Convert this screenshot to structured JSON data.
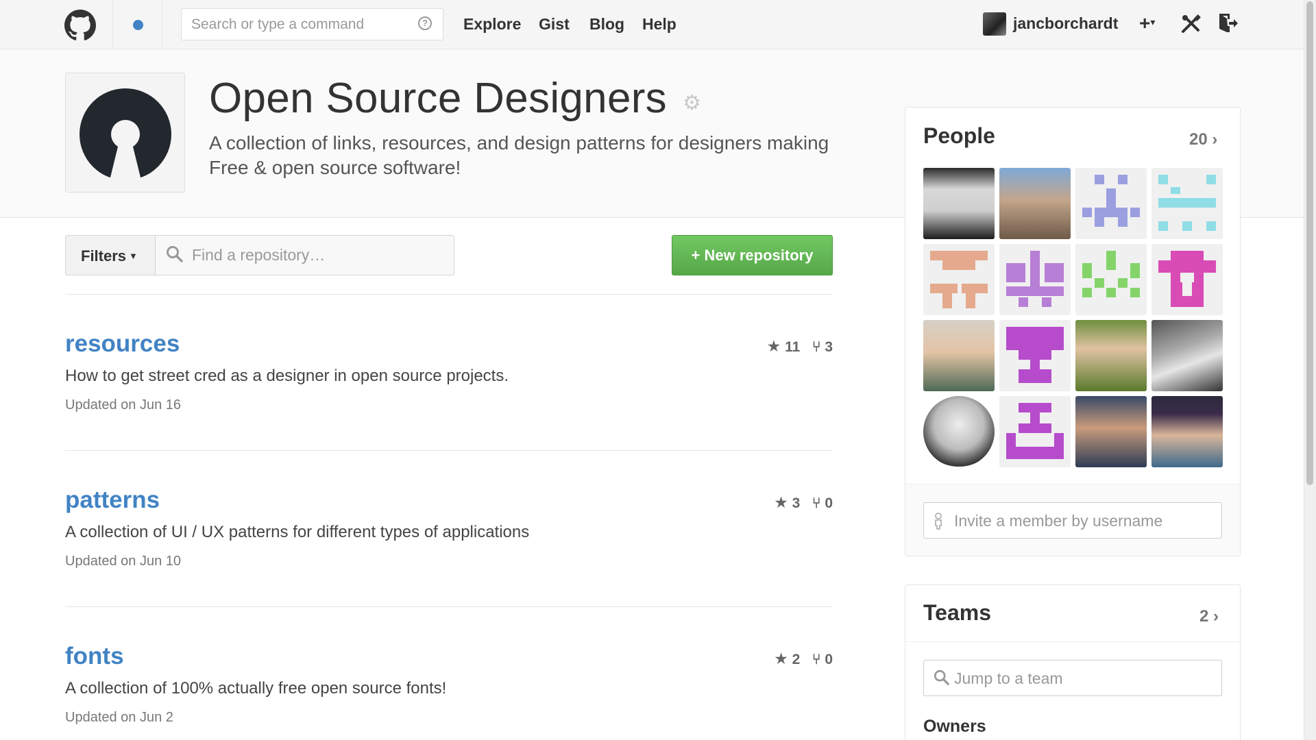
{
  "header": {
    "search_placeholder": "Search or type a command",
    "search_help": "?",
    "nav": [
      "Explore",
      "Gist",
      "Blog",
      "Help"
    ],
    "username": "jancborchardt",
    "icons": [
      "github-logo-icon",
      "notification-dot-icon",
      "plus-icon",
      "tools-icon",
      "sign-out-icon"
    ]
  },
  "org": {
    "name": "Open Source Designers",
    "description": "A collection of links, resources, and design patterns for designers making Free & open source software!"
  },
  "toolbar": {
    "filters_label": "Filters",
    "find_placeholder": "Find a repository…",
    "new_repo_label": "+ New repository"
  },
  "repos": [
    {
      "name": "resources",
      "description": "How to get street cred as a designer in open source projects.",
      "updated": "Updated on Jun 16",
      "stars": "11",
      "forks": "3"
    },
    {
      "name": "patterns",
      "description": "A collection of UI / UX patterns for different types of applications",
      "updated": "Updated on Jun 10",
      "stars": "3",
      "forks": "0"
    },
    {
      "name": "fonts",
      "description": "A collection of 100% actually free open source fonts!",
      "updated": "Updated on Jun 2",
      "stars": "2",
      "forks": "0"
    }
  ],
  "people": {
    "title": "People",
    "count": "20",
    "invite_placeholder": "Invite a member by username"
  },
  "teams": {
    "title": "Teams",
    "count": "2",
    "jump_placeholder": "Jump to a team",
    "owners_label": "Owners"
  },
  "colors": {
    "link": "#4183c4",
    "new_repo_green": "#60b552",
    "identicon_blue": "#9b9fe0",
    "identicon_cyan": "#8fdde5",
    "identicon_salmon": "#e5a98d",
    "identicon_lilac": "#b77fd6",
    "identicon_lime": "#84d46a",
    "identicon_magenta": "#d94bb5",
    "identicon_purple": "#b64ccb"
  }
}
